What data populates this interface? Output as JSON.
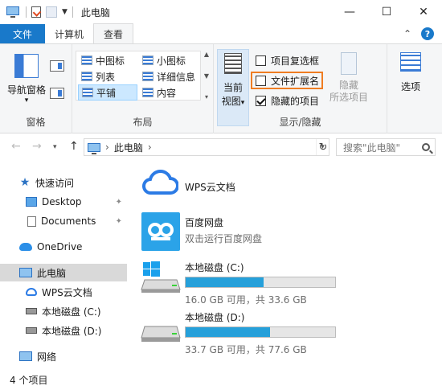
{
  "window": {
    "title": "此电脑",
    "minimize": "—",
    "maximize": "☐",
    "close": "✕"
  },
  "tabs": {
    "file": "文件",
    "computer": "计算机",
    "view": "查看",
    "collapse": "⌃",
    "help": "?"
  },
  "ribbon": {
    "panes": {
      "nav_pane": "导航窗格",
      "nav_pane_arrow": "▾",
      "label": "窗格"
    },
    "layout": {
      "items": [
        "中图标",
        "小图标",
        "列表",
        "详细信息",
        "平铺",
        "内容"
      ],
      "selected": "平铺",
      "label": "布局"
    },
    "show_hide": {
      "current_view_line1": "当前",
      "current_view_line2": "视图",
      "current_view_arrow": "▾",
      "checkbox_item": "项目复选框",
      "checkbox_item_checked": false,
      "file_ext": "文件扩展名",
      "file_ext_checked": false,
      "hidden_items": "隐藏的项目",
      "hidden_items_checked": true,
      "hide_line1": "隐藏",
      "hide_line2": "所选项目",
      "label": "显示/隐藏"
    },
    "options": {
      "label": "选项"
    }
  },
  "address": {
    "back": "←",
    "forward": "→",
    "recent": "▾",
    "up": "↑",
    "path": "此电脑",
    "path_sep": "›",
    "dropdown": "▾",
    "refresh": "↻",
    "search_placeholder": "搜索\"此电脑\""
  },
  "nav": {
    "quick_access": "快速访问",
    "desktop": "Desktop",
    "documents": "Documents",
    "pin": "✦",
    "onedrive": "OneDrive",
    "this_pc": "此电脑",
    "wps": "WPS云文档",
    "drive_c": "本地磁盘 (C:)",
    "drive_d": "本地磁盘 (D:)",
    "network": "网络"
  },
  "content": {
    "wps": {
      "name": "WPS云文档"
    },
    "baidu": {
      "name": "百度网盘",
      "sub": "双击运行百度网盘"
    },
    "drive_c": {
      "name": "本地磁盘 (C:)",
      "free_fraction": 0.524,
      "used_fraction": 0.524,
      "space": "16.0 GB 可用，共 33.6 GB"
    },
    "drive_d": {
      "name": "本地磁盘 (D:)",
      "used_fraction": 0.566,
      "space": "33.7 GB 可用，共 77.6 GB"
    }
  },
  "status": {
    "count": "4 个项目"
  },
  "colors": {
    "accent": "#1979ca",
    "highlight": "#ef7d22",
    "bar": "#26a0da"
  }
}
